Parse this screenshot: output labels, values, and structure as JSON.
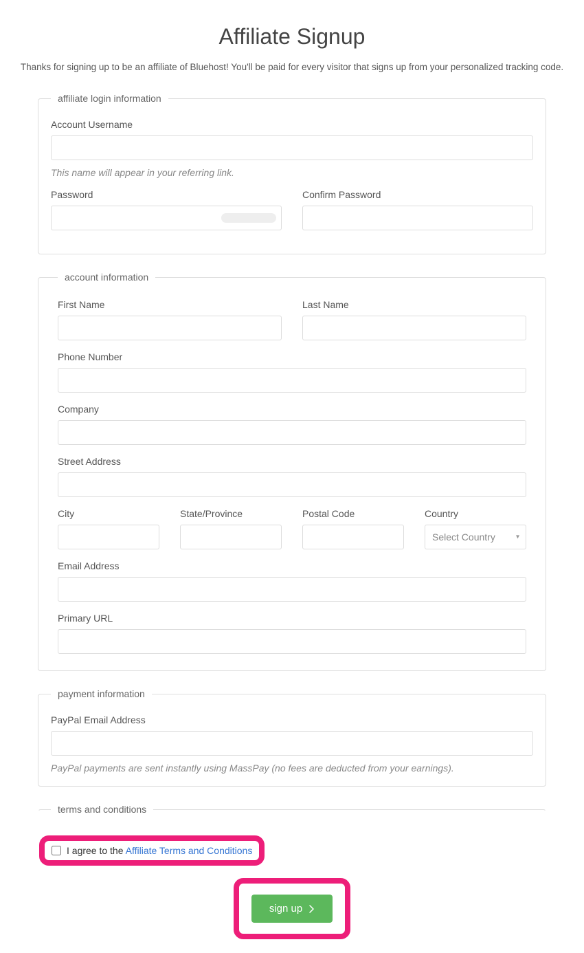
{
  "title": "Affiliate Signup",
  "intro": "Thanks for signing up to be an affiliate of Bluehost! You'll be paid for every visitor that signs up from your personalized tracking code.",
  "login": {
    "legend": "affiliate login information",
    "username_label": "Account Username",
    "username_hint": "This name will appear in your referring link.",
    "password_label": "Password",
    "confirm_label": "Confirm Password"
  },
  "account": {
    "legend": "account information",
    "first_name_label": "First Name",
    "last_name_label": "Last Name",
    "phone_label": "Phone Number",
    "company_label": "Company",
    "street_label": "Street Address",
    "city_label": "City",
    "state_label": "State/Province",
    "postal_label": "Postal Code",
    "country_label": "Country",
    "country_selected": "Select Country",
    "email_label": "Email Address",
    "url_label": "Primary URL"
  },
  "payment": {
    "legend": "payment information",
    "paypal_label": "PayPal Email Address",
    "paypal_hint": "PayPal payments are sent instantly using MassPay (no fees are deducted from your earnings)."
  },
  "terms": {
    "legend": "terms and conditions",
    "prefix": "I agree to the ",
    "link_text": "Affiliate Terms and Conditions"
  },
  "signup_label": "sign up"
}
